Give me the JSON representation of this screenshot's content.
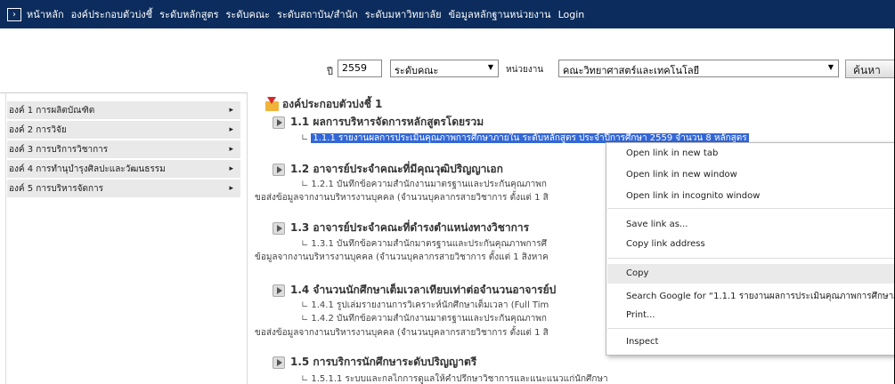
{
  "nav": {
    "items": [
      "หน้าหลัก",
      "องค์ประกอบตัวบ่งชี้",
      "ระดับหลักสูตร",
      "ระดับคณะ",
      "ระดับสถาบัน/สำนัก",
      "ระดับมหาวิทยาลัย",
      "ข้อมูลหลักฐานหน่วยงาน",
      "Login"
    ]
  },
  "filter": {
    "year_label": "ปี",
    "year_value": "2559",
    "level_value": "ระดับคณะ",
    "unit_label": "หน่วยงาน",
    "unit_value": "คณะวิทยาศาสตร์และเทคโนโลยี",
    "search_button": "ค้นหา"
  },
  "sidebar": {
    "items": [
      "องค์ 1 การผลิตบัณฑิต",
      "องค์ 2 การวิจัย",
      "องค์ 3 การบริการวิชาการ",
      "องค์ 4 การทำนุบำรุงศิลปะและวัฒนธรรม",
      "องค์ 5 การบริหารจัดการ"
    ]
  },
  "main": {
    "root_title": "องค์ประกอบตัวบ่งชี้ 1",
    "s1": {
      "title": "1.1 ผลการบริหารจัดการหลักสูตรโดยรวม",
      "sub1": "1.1.1 รายงานผลการประเมินคุณภาพการศึกษาภายใน ระดับหลักสูตร ประจำปีการศึกษา 2559 จำนวน 8 หลักสูตร"
    },
    "s2": {
      "title": "1.2 อาจารย์ประจำคณะที่มีคุณวุฒิปริญญาเอก",
      "sub1": "1.2.1 บันทึกข้อความสำนักงานมาตรฐานและประกันคุณภาพก",
      "cont": "ขอส่งข้อมูลจากงานบริหารงานบุคคล (จำนวนบุคลากรสายวิชาการ ตั้งแต่ 1 สิ"
    },
    "s3": {
      "title": "1.3 อาจารย์ประจำคณะที่ดำรงตำแหน่งทางวิชาการ",
      "sub1": "1.3.1 บันทึกข้อความสำนักมาตรฐานและประกันคุณภาพการศึ",
      "cont": "ข้อมูลจากงานบริหารงานบุคคล (จำนวนบุคลากรสายวิชาการ ตั้งแต่ 1 สิงหาค"
    },
    "s4": {
      "title": "1.4 จำนวนนักศึกษาเต็มเวลาเทียบเท่าต่อจำนวนอาจารย์ป",
      "sub1": "1.4.1 รูปเล่มรายงานการวิเคราะห์นักศึกษาเต็มเวลา (Full Tim",
      "sub2": "1.4.2 บันทึกข้อความสำนักงานมาตรฐานและประกันคุณภาพก",
      "cont": "ขอส่งข้อมูลจากงานบริหารงานบุคคล (จำนวนบุคลากรสายวิชาการ ตั้งแต่ 1 สิ"
    },
    "s5": {
      "title": "1.5 การบริการนักศึกษาระดับปริญญาตรี",
      "sub1": "1.5.1.1 ระบบและกลไกการดูแลให้คำปรึกษาวิชาการและแนะแนวแก่นักศึกษา"
    }
  },
  "context_menu": {
    "open_new_tab": "Open link in new tab",
    "open_new_window": "Open link in new window",
    "open_incognito": "Open link in incognito window",
    "save_link": "Save link as...",
    "copy_link": "Copy link address",
    "copy": "Copy",
    "search_google": "Search Google for “1.1.1 รายงานผลการประเมินคุณภาพการศึกษาภ",
    "print": "Print...",
    "inspect": "Inspect"
  }
}
